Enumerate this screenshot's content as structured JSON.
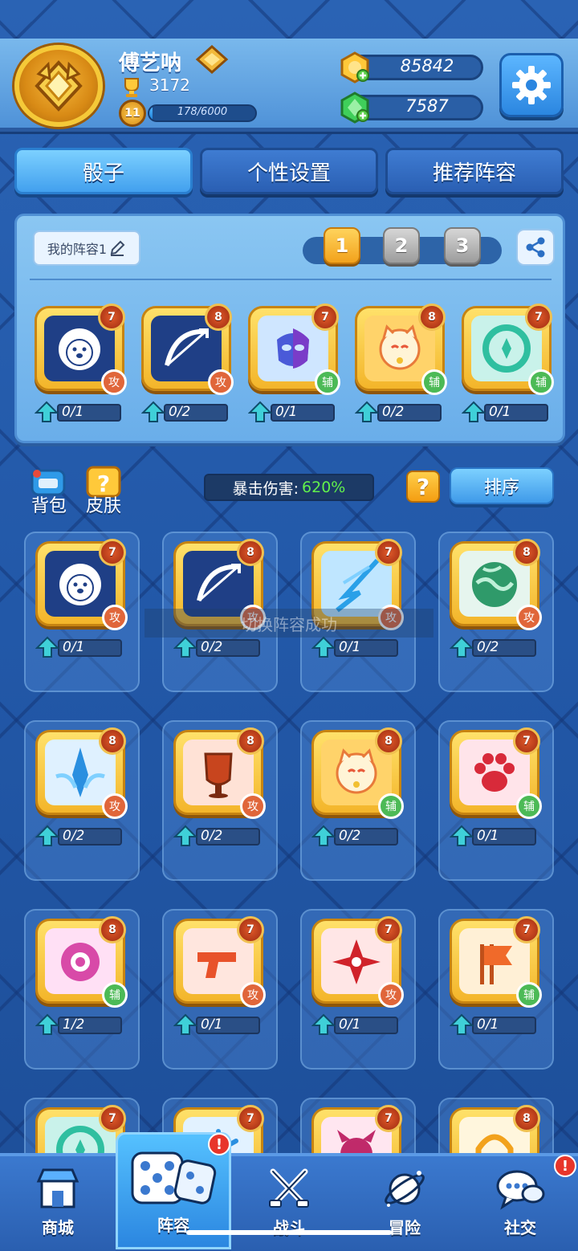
{
  "colors": {
    "accent_gold": "#f3b52a",
    "panel_blue": "#6aaeea",
    "attack": "#e0663a",
    "support": "#4cba56",
    "crit_green": "#61f04c"
  },
  "player": {
    "name": "傅艺呐",
    "trophies": "3172",
    "level": "11",
    "xp_text": "178/6000",
    "xp_fraction": 0.0297
  },
  "currency": {
    "coins": "85842",
    "gems": "7587",
    "coin_icon": "coin-icon",
    "gem_icon": "gem-icon"
  },
  "tabs": [
    {
      "label": "骰子"
    },
    {
      "label": "个性设置"
    },
    {
      "label": "推荐阵容"
    }
  ],
  "deck": {
    "name": "我的阵容1",
    "slots": [
      "1",
      "2",
      "3"
    ],
    "active_slot": "1",
    "dice": [
      {
        "name": "lion",
        "level": "7",
        "type": "攻",
        "progress": "0/1"
      },
      {
        "name": "bow",
        "level": "8",
        "type": "攻",
        "progress": "0/2"
      },
      {
        "name": "mask",
        "level": "7",
        "type": "辅",
        "progress": "0/1"
      },
      {
        "name": "lucky-cat",
        "level": "8",
        "type": "辅",
        "progress": "0/2"
      },
      {
        "name": "wind",
        "level": "7",
        "type": "辅",
        "progress": "0/1"
      }
    ]
  },
  "toolbar": {
    "backpack_label": "背包",
    "skins_label": "皮肤",
    "crit_label": "暴击伤害:",
    "crit_value": "620%",
    "help_label": "?",
    "sort_label": "排序"
  },
  "toast": "切换阵容成功",
  "collection": [
    {
      "name": "lion",
      "level": "7",
      "type": "攻",
      "progress": "0/1"
    },
    {
      "name": "bow",
      "level": "8",
      "type": "攻",
      "progress": "0/2"
    },
    {
      "name": "lightning",
      "level": "7",
      "type": "攻",
      "progress": "0/1"
    },
    {
      "name": "poison",
      "level": "8",
      "type": "攻",
      "progress": "0/2"
    },
    {
      "name": "ice-shard",
      "level": "8",
      "type": "攻",
      "progress": "0/2"
    },
    {
      "name": "shield",
      "level": "8",
      "type": "攻",
      "progress": "0/2"
    },
    {
      "name": "lucky-cat",
      "level": "8",
      "type": "辅",
      "progress": "0/2"
    },
    {
      "name": "paw",
      "level": "7",
      "type": "辅",
      "progress": "0/1"
    },
    {
      "name": "eye",
      "level": "8",
      "type": "辅",
      "progress": "1/2"
    },
    {
      "name": "gun",
      "level": "7",
      "type": "攻",
      "progress": "0/1"
    },
    {
      "name": "shuriken",
      "level": "7",
      "type": "攻",
      "progress": "0/1"
    },
    {
      "name": "flag",
      "level": "7",
      "type": "辅",
      "progress": "0/1"
    },
    {
      "name": "wind",
      "level": "7",
      "type": "",
      "progress": ""
    },
    {
      "name": "snowflake",
      "level": "7",
      "type": "",
      "progress": ""
    },
    {
      "name": "devil",
      "level": "7",
      "type": "",
      "progress": ""
    },
    {
      "name": "arch",
      "level": "8",
      "type": "",
      "progress": ""
    }
  ],
  "bottom_nav": [
    {
      "label": "商城",
      "icon": "shop-icon"
    },
    {
      "label": "阵容",
      "icon": "dice-icon",
      "alert": "!"
    },
    {
      "label": "战斗",
      "icon": "swords-icon"
    },
    {
      "label": "冒险",
      "icon": "planet-icon"
    },
    {
      "label": "社交",
      "icon": "chat-icon",
      "alert": "!"
    }
  ]
}
